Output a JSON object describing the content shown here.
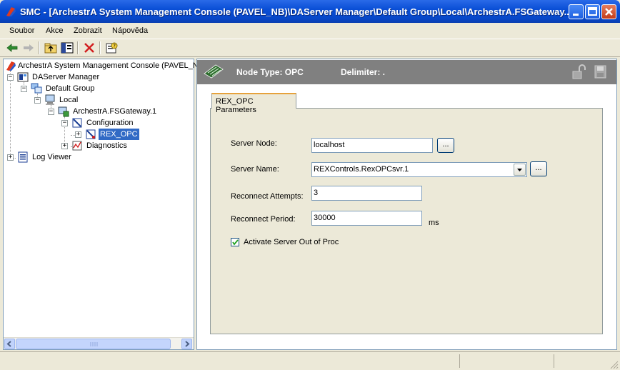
{
  "window": {
    "title": "SMC - [ArchestrA System Management Console (PAVEL_NB)\\DAServer Manager\\Default Group\\Local\\ArchestrA.FSGateway...."
  },
  "menu": [
    "Soubor",
    "Akce",
    "Zobrazit",
    "Nápověda"
  ],
  "tree": {
    "root": "ArchestrA System Management Console (PAVEL_N",
    "daserver_manager": "DAServer Manager",
    "default_group": "Default Group",
    "local": "Local",
    "fsgateway": "ArchestrA.FSGateway.1",
    "configuration": "Configuration",
    "rex_opc": "REX_OPC",
    "diagnostics": "Diagnostics",
    "log_viewer": "Log Viewer"
  },
  "header": {
    "node_type": "Node Type: OPC",
    "delimiter": "Delimiter:  ."
  },
  "tab": {
    "label": "REX_OPC Parameters"
  },
  "form": {
    "server_node_label": "Server Node:",
    "server_node_value": "localhost",
    "server_name_label": "Server Name:",
    "server_name_value": "REXControls.RexOPCsvr.1",
    "reconnect_attempts_label": "Reconnect Attempts:",
    "reconnect_attempts_value": "3",
    "reconnect_period_label": "Reconnect Period:",
    "reconnect_period_value": "30000",
    "reconnect_period_unit": "ms",
    "activate_label": "Activate Server Out of Proc",
    "activate_checked": true,
    "browse_label": "..."
  },
  "colors": {
    "title_bar": "#0a4fd6",
    "selection": "#316ac5",
    "header_bg": "#808080",
    "tab_accent": "#e6a23c"
  },
  "icons": [
    "back-arrow-icon",
    "forward-arrow-icon",
    "up-folder-icon",
    "show-tree-icon",
    "delete-icon",
    "properties-icon",
    "save-icon",
    "lock-icon"
  ]
}
